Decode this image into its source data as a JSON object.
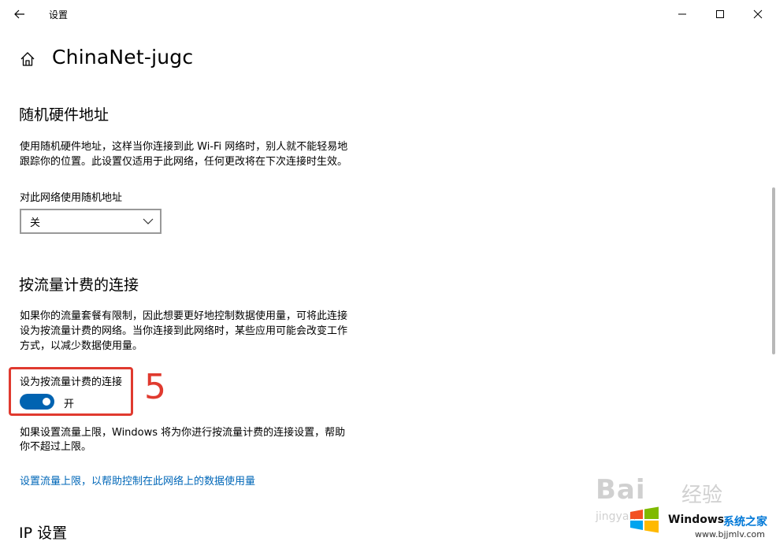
{
  "window": {
    "app_title": "设置",
    "controls": {
      "minimize": "minimize",
      "maximize": "maximize",
      "close": "close"
    }
  },
  "header": {
    "page_title": "ChinaNet-jugc"
  },
  "random_hw": {
    "title": "随机硬件地址",
    "desc_line1": "使用随机硬件地址，这样当你连接到此 Wi-Fi 网络时，别人就不能轻易地",
    "desc_line2": "跟踪你的位置。此设置仅适用于此网络，任何更改将在下次连接时生效。",
    "dropdown_label": "对此网络使用随机地址",
    "dropdown_value": "关"
  },
  "metered": {
    "title": "按流量计费的连接",
    "desc_line1": "如果你的流量套餐有限制，因此想要更好地控制数据使用量，可将此连接",
    "desc_line2": "设为按流量计费的网络。当你连接到此网络时，某些应用可能会改变工作",
    "desc_line3": "方式，以减少数据使用量。",
    "toggle_label": "设为按流量计费的连接",
    "toggle_state": "开",
    "toggle_on": true,
    "annotation_number": "5",
    "limit_line1": "如果设置流量上限，Windows 将为你进行按流量计费的连接设置，帮助",
    "limit_line2": "你不超过上限。",
    "link": "设置流量上限，以帮助控制在此网络上的数据使用量"
  },
  "ip": {
    "title": "IP 设置"
  },
  "watermark": {
    "baidu": "Bai",
    "jingyan": "经验",
    "jy_small": "jingyan",
    "brand": "Windows",
    "brand_cn": "系统之家",
    "url": "www.bjjmlv.com"
  },
  "colors": {
    "accent": "#0063b1",
    "link": "#0067b8",
    "annotation": "#e03a2f"
  }
}
